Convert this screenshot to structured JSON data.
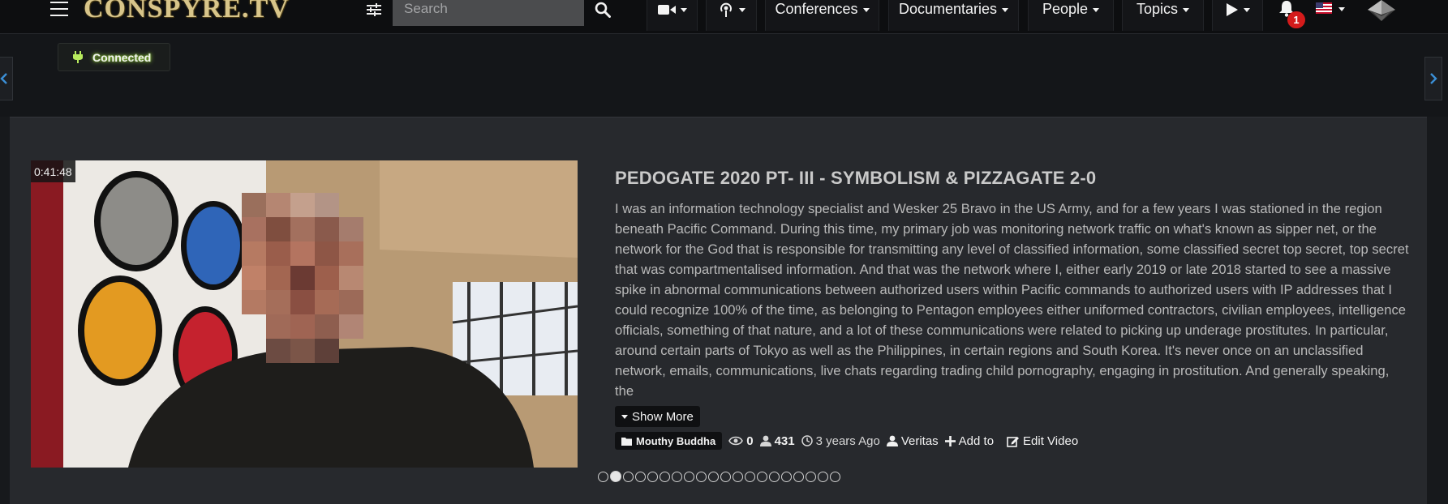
{
  "nav": {
    "logo": "CONSPYRE.TV",
    "search_placeholder": "Search",
    "menus": [
      {
        "label": "Conferences"
      },
      {
        "label": "Documentaries"
      },
      {
        "label": "People"
      },
      {
        "label": "Topics"
      }
    ],
    "icons": {
      "menu": "hamburger-icon",
      "filter": "sliders-icon",
      "search": "search-icon",
      "video": "video-camera-icon",
      "broadcast": "podcast-icon",
      "play": "play-icon",
      "notifications": "bell-icon",
      "language": "us-flag-icon",
      "crypto": "ethereum-icon"
    },
    "notification_count": "1"
  },
  "status": {
    "connection_label": "Connected",
    "glow_color": "#a6e04a"
  },
  "featured": {
    "duration": "0:41:48",
    "title": "PEDOGATE 2020 PT- III - SYMBOLISM & PIZZAGATE 2-0",
    "description": "I was an information technology specialist and Wesker 25 Bravo in the US Army, and for a few years I was stationed in the region beneath Pacific Command. During this time, my primary job was monitoring network traffic on what's known as sipper net, or the network for the God that is responsible for transmitting any level of classified information, some classified secret top secret, top secret that was compartmentalised information. And that was the network where I, either early 2019 or late 2018 started to see a massive spike in abnormal communications between authorized users within Pacific commands to authorized users with IP addresses that I could recognize 100% of the time, as belonging to Pentagon employees either uniformed contractors, civilian employees, intelligence officials, something of that nature, and a lot of these communications were related to picking up underage prostitutes. In particular, around certain parts of Tokyo as well as the Philippines, in certain regions and South Korea. It's never once on an unclassified network, emails, communications, live chats regarding trading child pornography, engaging in prostitution. And generally speaking, the",
    "show_more_label": "Show More",
    "channel": "Mouthy Buddha",
    "views": "0",
    "subscribers": "431",
    "age": "3 years Ago",
    "author": "Veritas",
    "add_to_label": "Add to",
    "edit_label": "Edit Video",
    "slides_total": 20,
    "slide_active": 2
  }
}
